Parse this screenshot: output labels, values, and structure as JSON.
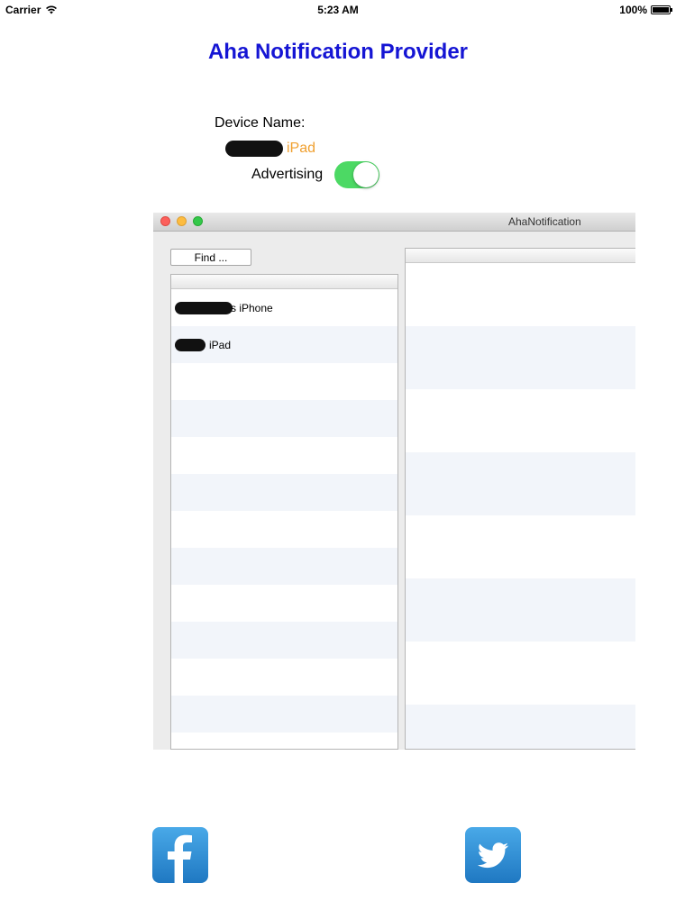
{
  "status_bar": {
    "carrier": "Carrier",
    "time": "5:23 AM",
    "battery": "100%"
  },
  "title": "Aha Notification Provider",
  "device": {
    "label": "Device Name:",
    "value": "iPad",
    "advertising_label": "Advertising",
    "advertising_on": true
  },
  "mac_window": {
    "title": "AhaNotification",
    "find_button": "Find ...",
    "devices": [
      "s iPhone",
      "iPad"
    ]
  },
  "social": {
    "facebook_icon": "facebook-icon",
    "twitter_icon": "twitter-icon"
  },
  "colors": {
    "title": "#1515d4",
    "device_value": "#f0a030",
    "toggle_on": "#4cd964",
    "social_bg": "#2a8ad4"
  }
}
